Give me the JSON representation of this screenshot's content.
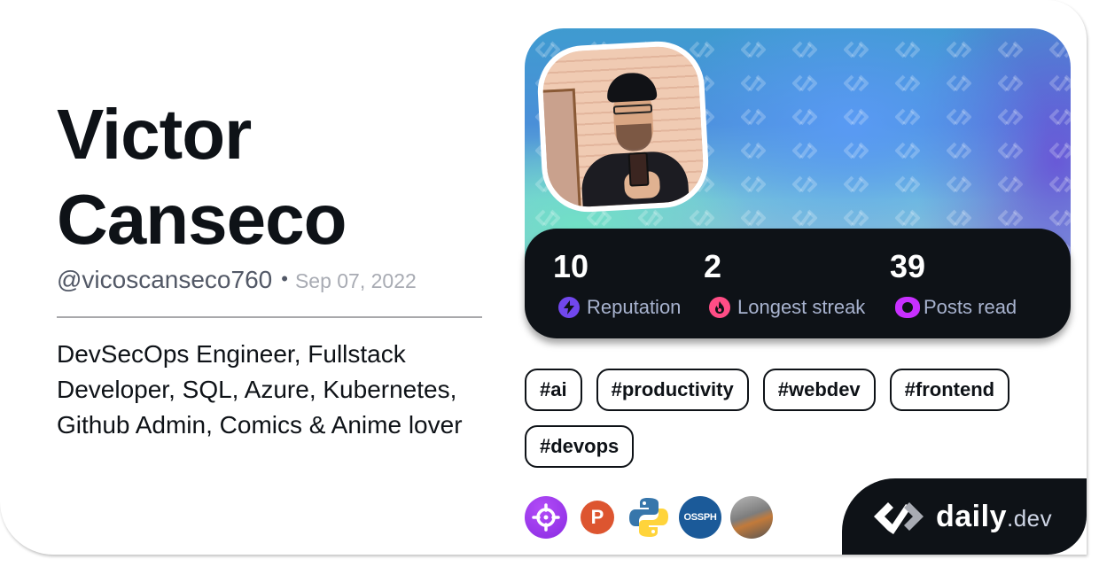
{
  "profile": {
    "name_line1": "Victor",
    "name_line2": "Canseco",
    "handle": "@vicoscanseco760",
    "separator": "•",
    "joined": "Sep 07, 2022",
    "bio": "DevSecOps Engineer, Fullstack Developer, SQL, Azure, Kubernetes, Github Admin, Comics & Anime lover"
  },
  "avatar": {
    "alt": "Profile picture of Victor Canseco"
  },
  "stats": [
    {
      "value": "10",
      "label": "Reputation",
      "icon": "lightning-icon",
      "color": "#7147ed"
    },
    {
      "value": "2",
      "label": "Longest streak",
      "icon": "flame-icon",
      "color": "#ff4d86"
    },
    {
      "value": "39",
      "label": "Posts read",
      "icon": "eye-ring-icon",
      "color": "#c830ff"
    }
  ],
  "tags": [
    "#ai",
    "#productivity",
    "#webdev",
    "#frontend",
    "#devops"
  ],
  "squads": [
    {
      "name": "crosshair-squad",
      "icon": "crosshair-icon",
      "color": "#9d3cf2"
    },
    {
      "name": "p-squad",
      "icon": "letter-p-icon",
      "letter": "P",
      "color": "#dd5530"
    },
    {
      "name": "python-squad",
      "icon": "python-icon",
      "color": "#3776ab"
    },
    {
      "name": "ossph-squad",
      "icon": "ossph-icon",
      "letter": "OSSPH",
      "color": "#1b5a99"
    },
    {
      "name": "photo-squad",
      "icon": "photo-icon",
      "color": "#8a8a8a"
    }
  ],
  "brand": {
    "name": "daily",
    "tld": ".dev"
  },
  "colors": {
    "text_primary": "#0e1217",
    "text_secondary": "#525866",
    "panel_bg": "#0e1217",
    "label": "#a8b3cf"
  }
}
